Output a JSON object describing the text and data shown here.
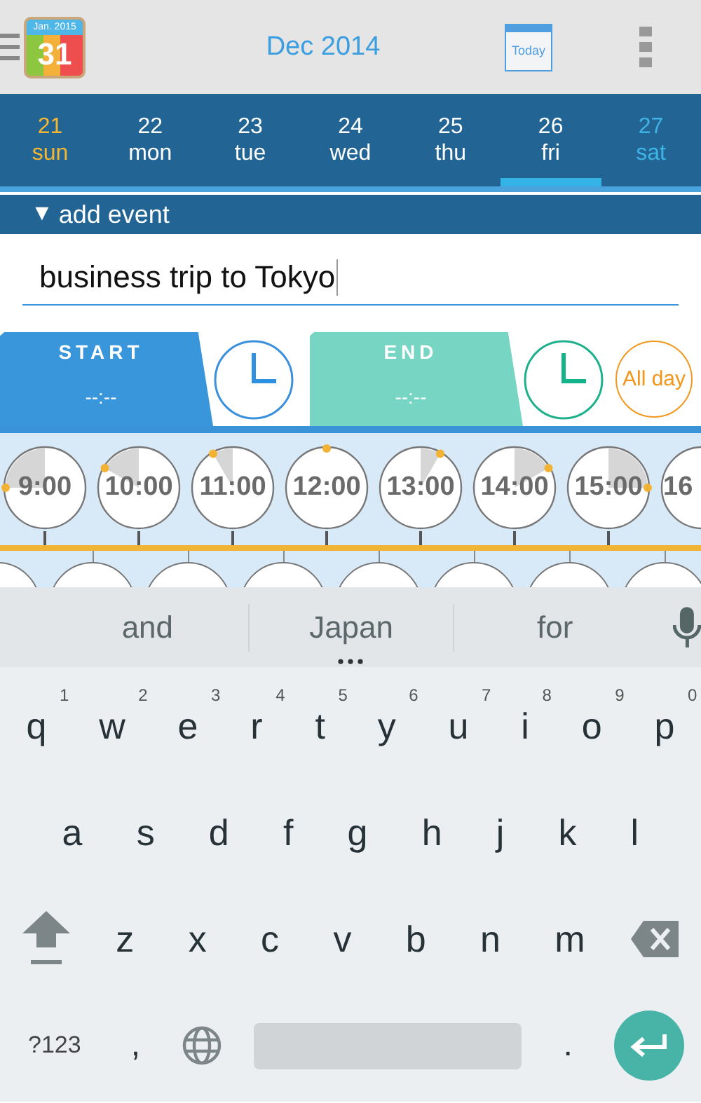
{
  "toolbar": {
    "app_icon": {
      "month": "Jan. 2015",
      "day": "31"
    },
    "title": "Dec 2014",
    "today_button": "Today"
  },
  "days": [
    {
      "day": "21",
      "weekday": "sun",
      "kind": "sunday",
      "selected": false
    },
    {
      "day": "22",
      "weekday": "mon",
      "kind": "weekday",
      "selected": false
    },
    {
      "day": "23",
      "weekday": "tue",
      "kind": "weekday",
      "selected": false
    },
    {
      "day": "24",
      "weekday": "wed",
      "kind": "weekday",
      "selected": false
    },
    {
      "day": "25",
      "weekday": "thu",
      "kind": "weekday",
      "selected": false
    },
    {
      "day": "26",
      "weekday": "fri",
      "kind": "weekday",
      "selected": true
    },
    {
      "day": "27",
      "weekday": "sat",
      "kind": "saturday",
      "selected": false
    }
  ],
  "add_event": {
    "arrow": "▼",
    "label": "add event",
    "expanded": true
  },
  "title_field": {
    "value": "business trip to Tokyo"
  },
  "start_tab": {
    "label": "START",
    "time": "--:--"
  },
  "end_tab": {
    "label": "END",
    "time": "--:--"
  },
  "all_day_button": "All day",
  "hour_clocks": [
    {
      "label": "9:00"
    },
    {
      "label": "10:00"
    },
    {
      "label": "11:00"
    },
    {
      "label": "12:00"
    },
    {
      "label": "13:00"
    },
    {
      "label": "14:00"
    },
    {
      "label": "15:00"
    },
    {
      "label": "16"
    }
  ],
  "keyboard": {
    "suggestions": [
      "and",
      "Japan",
      "for"
    ],
    "rows": [
      [
        {
          "label": "q",
          "hint": "1"
        },
        {
          "label": "w",
          "hint": "2"
        },
        {
          "label": "e",
          "hint": "3"
        },
        {
          "label": "r",
          "hint": "4"
        },
        {
          "label": "t",
          "hint": "5"
        },
        {
          "label": "y",
          "hint": "6"
        },
        {
          "label": "u",
          "hint": "7"
        },
        {
          "label": "i",
          "hint": "8"
        },
        {
          "label": "o",
          "hint": "9"
        },
        {
          "label": "p",
          "hint": "0"
        }
      ],
      [
        {
          "label": "a"
        },
        {
          "label": "s"
        },
        {
          "label": "d"
        },
        {
          "label": "f"
        },
        {
          "label": "g"
        },
        {
          "label": "h"
        },
        {
          "label": "j"
        },
        {
          "label": "k"
        },
        {
          "label": "l"
        }
      ],
      [
        {
          "label": "z"
        },
        {
          "label": "x"
        },
        {
          "label": "c"
        },
        {
          "label": "v"
        },
        {
          "label": "b"
        },
        {
          "label": "n"
        },
        {
          "label": "m"
        }
      ]
    ],
    "symbols_key": "?123",
    "comma_key": ",",
    "period_key": "."
  }
}
